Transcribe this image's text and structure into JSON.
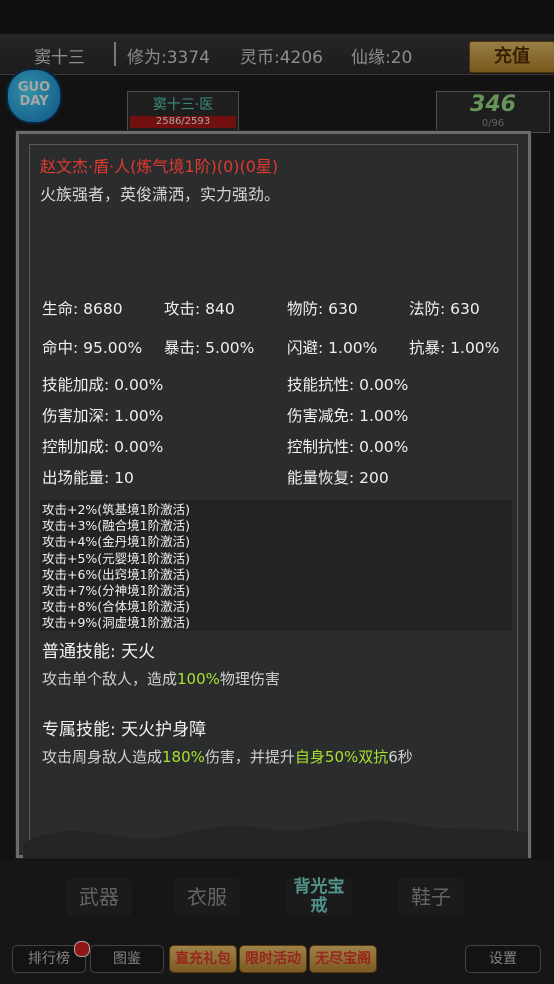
{
  "topbar": {
    "player_name": "窦十三",
    "cultivation": "修为:3374",
    "spirit_coin": "灵币:4206",
    "fortune": "仙缘:20",
    "recharge_label": "充值"
  },
  "logo": {
    "line1": "GUO",
    "line2": "DAY"
  },
  "hero_card": {
    "name": "窦十三·医",
    "hp": "2586/2593"
  },
  "power_card": {
    "value": "346",
    "sub": "0/96"
  },
  "detail": {
    "title": "赵文杰·盾·人(炼气境1阶)(0)(0星)",
    "description": "火族强者，英俊潇洒，实力强劲。",
    "stats_row1": [
      "生命: 8680",
      "攻击: 840",
      "物防: 630",
      "法防: 630"
    ],
    "stats_row2": [
      "命中: 95.00%",
      "暴击: 5.00%",
      "闪避: 1.00%",
      "抗暴: 1.00%"
    ],
    "stats_pairs": [
      [
        "技能加成: 0.00%",
        "技能抗性: 0.00%"
      ],
      [
        "伤害加深: 1.00%",
        "伤害减免: 1.00%"
      ],
      [
        "控制加成: 0.00%",
        "控制抗性: 0.00%"
      ],
      [
        "出场能量: 10",
        "能量恢复: 200"
      ]
    ],
    "buffs": [
      "攻击+2%(筑基境1阶激活)",
      "攻击+3%(融合境1阶激活)",
      "攻击+4%(金丹境1阶激活)",
      "攻击+5%(元婴境1阶激活)",
      "攻击+6%(出窍境1阶激活)",
      "攻击+7%(分神境1阶激活)",
      "攻击+8%(合体境1阶激活)",
      "攻击+9%(洞虚境1阶激活)"
    ],
    "skill_normal": {
      "title": "普通技能: 天火",
      "desc_a": "攻击单个敌人，造成",
      "desc_hl": "100%",
      "desc_b": "物理伤害"
    },
    "skill_special": {
      "title": "专属技能: 天火护身障",
      "desc_a": "攻击周身敌人造成",
      "desc_hl1": "180%",
      "desc_b": "伤害，并提升",
      "desc_hl2": "自身50%双抗",
      "desc_c": "6秒"
    }
  },
  "equipment_tabs": [
    "武器",
    "衣服",
    "背光宝戒",
    "鞋子"
  ],
  "bottom_buttons": {
    "ranking": "排行榜",
    "codex": "图鉴",
    "recharge_gift": "直充礼包",
    "limited_event": "限时活动",
    "endless_treasure": "无尽宝阁",
    "settings": "设置"
  }
}
